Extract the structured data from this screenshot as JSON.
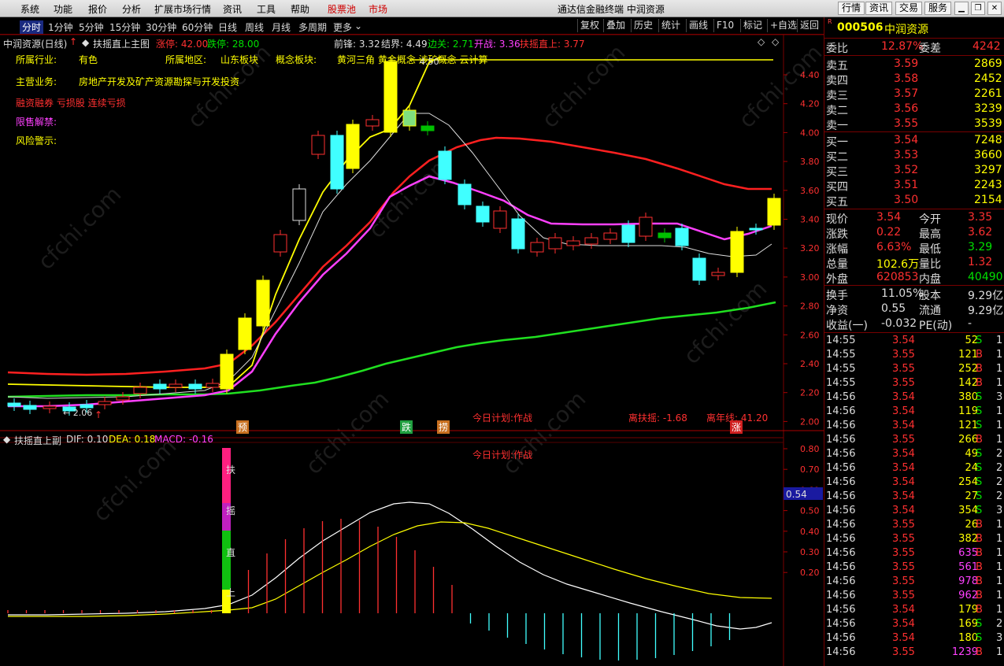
{
  "menu": {
    "items": [
      "系统",
      "功能",
      "报价",
      "分析",
      "扩展市场行情",
      "资讯",
      "工具",
      "帮助"
    ],
    "stockpool": "股票池",
    "market": "市场",
    "window_title": "通达信金融终端  中润资源",
    "right_buttons": [
      "行情",
      "资讯",
      "交易",
      "服务"
    ]
  },
  "periods": [
    "分时",
    "1分钟",
    "5分钟",
    "15分钟",
    "30分钟",
    "60分钟",
    "日线",
    "周线",
    "月线",
    "多周期",
    "更多"
  ],
  "toolbar_right": [
    "复权",
    "叠加",
    "历史",
    "统计",
    "画线",
    "F10",
    "标记",
    "+自选",
    "返回"
  ],
  "chart_header": {
    "stock": "中润资源(日线)",
    "indicator": "扶摇直上主图",
    "zt": "涨停: 42.00",
    "dt": "跌停: 28.00",
    "qianfeng": "前锋: 3.32",
    "jiejie": "结界: 4.49",
    "bianguan": "边关: 2.71",
    "kaizhan": "开战: 3.36",
    "fyzs": "扶摇直上: 3.77"
  },
  "info": {
    "industry_label": "所属行业:",
    "industry": "有色",
    "region_label": "所属地区:",
    "region": "山东板块",
    "concept_label": "概念板块:",
    "concept": "黄河三角 黄金概念 涉矿概念 云计算",
    "business_label": "主营业务:",
    "business": "房地产开发及矿产资源勘探与开发投资",
    "margin": "融资融券 亏损股 连续亏损",
    "unlock_label": "限售解禁:",
    "risk_label": "风险警示:"
  },
  "annotations": {
    "low_price": "← 2.06",
    "high_price": "4.50",
    "plan": "今日计划:作战",
    "dev1": "离扶摇: -1.68",
    "dev2": "离年线: 41.20",
    "tag_yu": "预",
    "tag_die": "跌",
    "tag_lao": "捞",
    "tag_zhang": "涨"
  },
  "main_y_ticks": [
    "4.40",
    "4.20",
    "4.00",
    "3.80",
    "3.60",
    "3.40",
    "3.20",
    "3.00",
    "2.80",
    "2.60",
    "2.40",
    "2.20",
    "2.00"
  ],
  "sub_header": {
    "name": "扶摇直上副",
    "dif": "DIF: 0.10",
    "dea": "DEA: 0.18",
    "macd": "MACD: -0.16",
    "plan": "今日计划:作战",
    "vertical_text": [
      "扶",
      "摇",
      "直",
      "上"
    ]
  },
  "sub_y_ticks": [
    "0.80",
    "0.70",
    "0.60",
    "0.50",
    "0.40",
    "0.30",
    "0.20"
  ],
  "sub_marker": "0.54",
  "quote": {
    "code": "000506",
    "name": "中润资源",
    "ratio_label": "委比",
    "ratio": "12.87%",
    "diff_label": "委差",
    "diff": "4242",
    "asks": [
      {
        "label": "卖五",
        "price": "3.59",
        "vol": "2869"
      },
      {
        "label": "卖四",
        "price": "3.58",
        "vol": "2452"
      },
      {
        "label": "卖三",
        "price": "3.57",
        "vol": "2261"
      },
      {
        "label": "卖二",
        "price": "3.56",
        "vol": "3239"
      },
      {
        "label": "卖一",
        "price": "3.55",
        "vol": "3539"
      }
    ],
    "bids": [
      {
        "label": "买一",
        "price": "3.54",
        "vol": "7248"
      },
      {
        "label": "买二",
        "price": "3.53",
        "vol": "3660"
      },
      {
        "label": "买三",
        "price": "3.52",
        "vol": "3297"
      },
      {
        "label": "买四",
        "price": "3.51",
        "vol": "2243"
      },
      {
        "label": "买五",
        "price": "3.50",
        "vol": "2154"
      }
    ],
    "stats": [
      {
        "l1": "现价",
        "v1": "3.54",
        "l2": "今开",
        "v2": "3.35"
      },
      {
        "l1": "涨跌",
        "v1": "0.22",
        "l2": "最高",
        "v2": "3.62"
      },
      {
        "l1": "涨幅",
        "v1": "6.63%",
        "l2": "最低",
        "v2": "3.29"
      },
      {
        "l1": "总量",
        "v1": "102.6万",
        "l2": "量比",
        "v2": "1.32"
      },
      {
        "l1": "外盘",
        "v1": "620853",
        "l2": "内盘",
        "v2": "404901"
      }
    ],
    "stats2": [
      {
        "l1": "换手",
        "v1": "11.05%",
        "l2": "股本",
        "v2": "9.29亿"
      },
      {
        "l1": "净资",
        "v1": "0.55",
        "l2": "流通",
        "v2": "9.29亿"
      },
      {
        "l1": "收益(一)",
        "v1": "-0.032",
        "l2": "PE(动)",
        "v2": "-"
      }
    ],
    "ticks": [
      {
        "t": "14:55",
        "p": "3.54",
        "v": "52",
        "d": "S",
        "n": "1"
      },
      {
        "t": "14:55",
        "p": "3.55",
        "v": "121",
        "d": "B",
        "n": "1"
      },
      {
        "t": "14:55",
        "p": "3.55",
        "v": "252",
        "d": "B",
        "n": "1"
      },
      {
        "t": "14:55",
        "p": "3.55",
        "v": "142",
        "d": "B",
        "n": "1"
      },
      {
        "t": "14:56",
        "p": "3.54",
        "v": "380",
        "d": "S",
        "n": "3"
      },
      {
        "t": "14:56",
        "p": "3.54",
        "v": "119",
        "d": "S",
        "n": "1"
      },
      {
        "t": "14:56",
        "p": "3.54",
        "v": "121",
        "d": "S",
        "n": "1"
      },
      {
        "t": "14:56",
        "p": "3.55",
        "v": "266",
        "d": "B",
        "n": "1"
      },
      {
        "t": "14:56",
        "p": "3.54",
        "v": "49",
        "d": "S",
        "n": "2"
      },
      {
        "t": "14:56",
        "p": "3.54",
        "v": "24",
        "d": "S",
        "n": "2"
      },
      {
        "t": "14:56",
        "p": "3.54",
        "v": "254",
        "d": "S",
        "n": "2"
      },
      {
        "t": "14:56",
        "p": "3.54",
        "v": "27",
        "d": "S",
        "n": "2"
      },
      {
        "t": "14:56",
        "p": "3.54",
        "v": "354",
        "d": "S",
        "n": "3"
      },
      {
        "t": "14:56",
        "p": "3.55",
        "v": "26",
        "d": "B",
        "n": "1"
      },
      {
        "t": "14:56",
        "p": "3.55",
        "v": "382",
        "d": "B",
        "n": "1"
      },
      {
        "t": "14:56",
        "p": "3.55",
        "v": "635",
        "d": "B",
        "n": "1"
      },
      {
        "t": "14:56",
        "p": "3.55",
        "v": "561",
        "d": "B",
        "n": "1"
      },
      {
        "t": "14:56",
        "p": "3.55",
        "v": "978",
        "d": "B",
        "n": "1"
      },
      {
        "t": "14:56",
        "p": "3.55",
        "v": "962",
        "d": "B",
        "n": "1"
      },
      {
        "t": "14:56",
        "p": "3.54",
        "v": "179",
        "d": "B",
        "n": "1"
      },
      {
        "t": "14:56",
        "p": "3.54",
        "v": "169",
        "d": "S",
        "n": "2"
      },
      {
        "t": "14:56",
        "p": "3.54",
        "v": "180",
        "d": "S",
        "n": "3"
      },
      {
        "t": "14:56",
        "p": "3.55",
        "v": "1239",
        "d": "B",
        "n": "1"
      }
    ]
  },
  "colors": {
    "up": "#ff3030",
    "down": "#40ffff",
    "ma_yellow": "#ffff00",
    "ma_magenta": "#ff40ff",
    "ma_red": "#ff2020",
    "ma_green": "#20e020"
  },
  "watermark": "cfchi.com"
}
